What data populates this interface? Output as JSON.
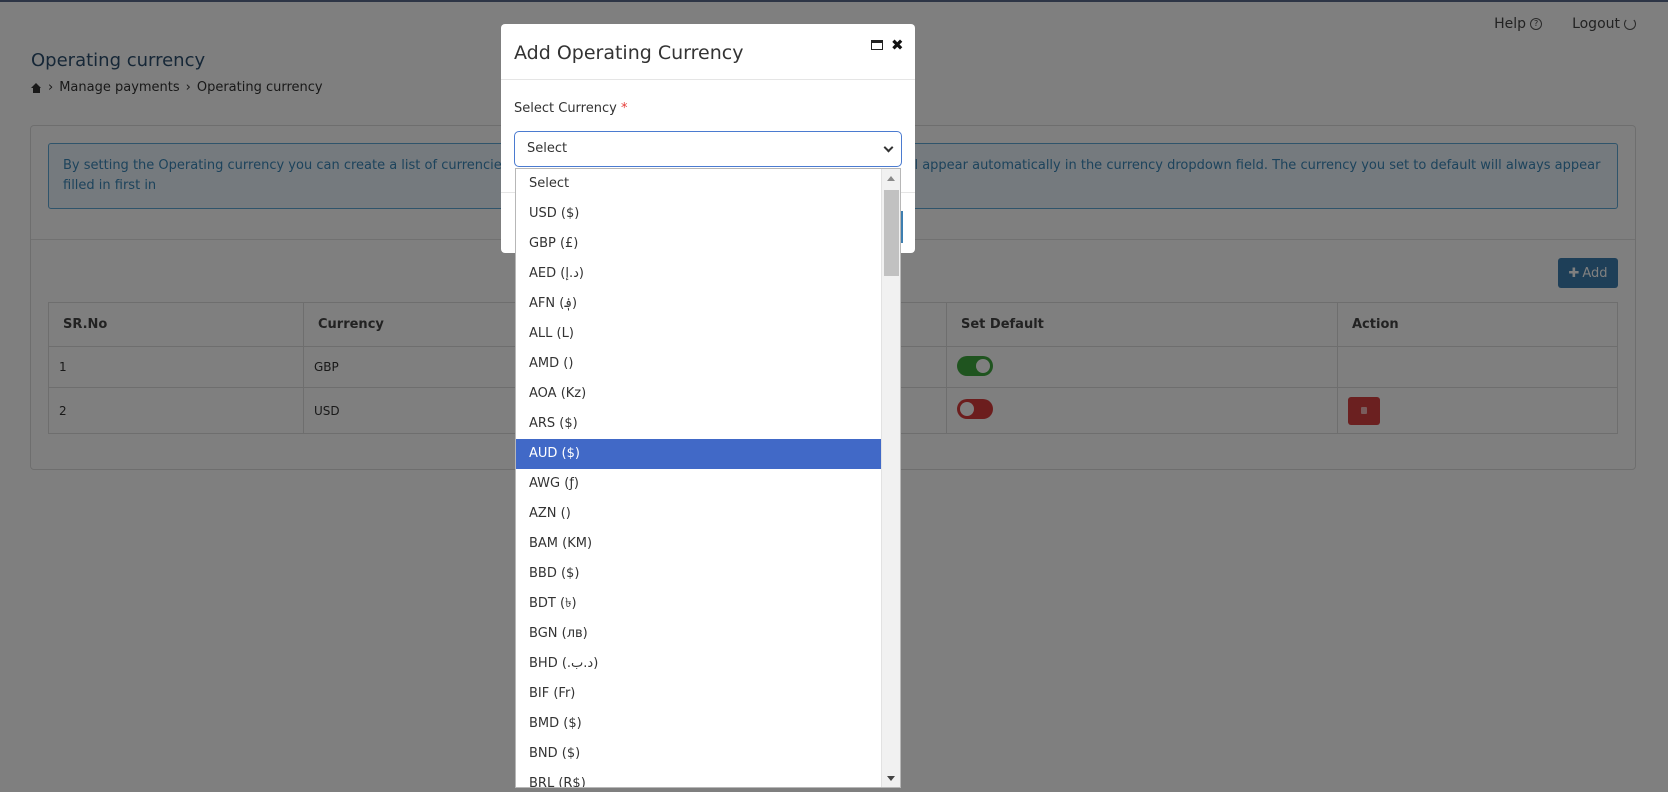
{
  "header": {
    "help_label": "Help",
    "logout_label": "Logout"
  },
  "page": {
    "title": "Operating currency",
    "breadcrumb": [
      "Manage payments",
      "Operating currency"
    ],
    "info_text": "By setting the Operating currency you can create a list of currencies y                                                                                                        e Agent Capture Assist screen. Any currency added here will appear automatically in the currency dropdown field. The currency you set to default will always appear filled in first in",
    "add_label": "Add"
  },
  "table": {
    "headers": [
      "SR.No",
      "Currency",
      "Set Default",
      "Action"
    ],
    "rows": [
      {
        "sr": "1",
        "currency": "GBP",
        "is_default": true
      },
      {
        "sr": "2",
        "currency": "USD",
        "is_default": false
      }
    ]
  },
  "modal": {
    "title": "Add Operating Currency",
    "field_label": "Select Currency",
    "required_mark": "*",
    "selected_value": "Select"
  },
  "dropdown": {
    "options": [
      "Select",
      "USD ($)",
      "GBP (£)",
      "AED (د.إ)",
      "AFN (؋)",
      "ALL (L)",
      "AMD ()",
      "AOA (Kz)",
      "ARS ($)",
      "AUD ($)",
      "AWG (ƒ)",
      "AZN ()",
      "BAM (KM)",
      "BBD ($)",
      "BDT (৳)",
      "BGN (лв)",
      "BHD (.د.ب)",
      "BIF (Fr)",
      "BMD ($)",
      "BND ($)",
      "BRL (R$)"
    ],
    "highlighted": "AUD ($)"
  },
  "colors": {
    "accent": "#3d7eb0",
    "highlight": "#4169c7",
    "toggle_on": "#3ea83e",
    "toggle_off": "#d83a3a",
    "delete": "#d64040"
  }
}
